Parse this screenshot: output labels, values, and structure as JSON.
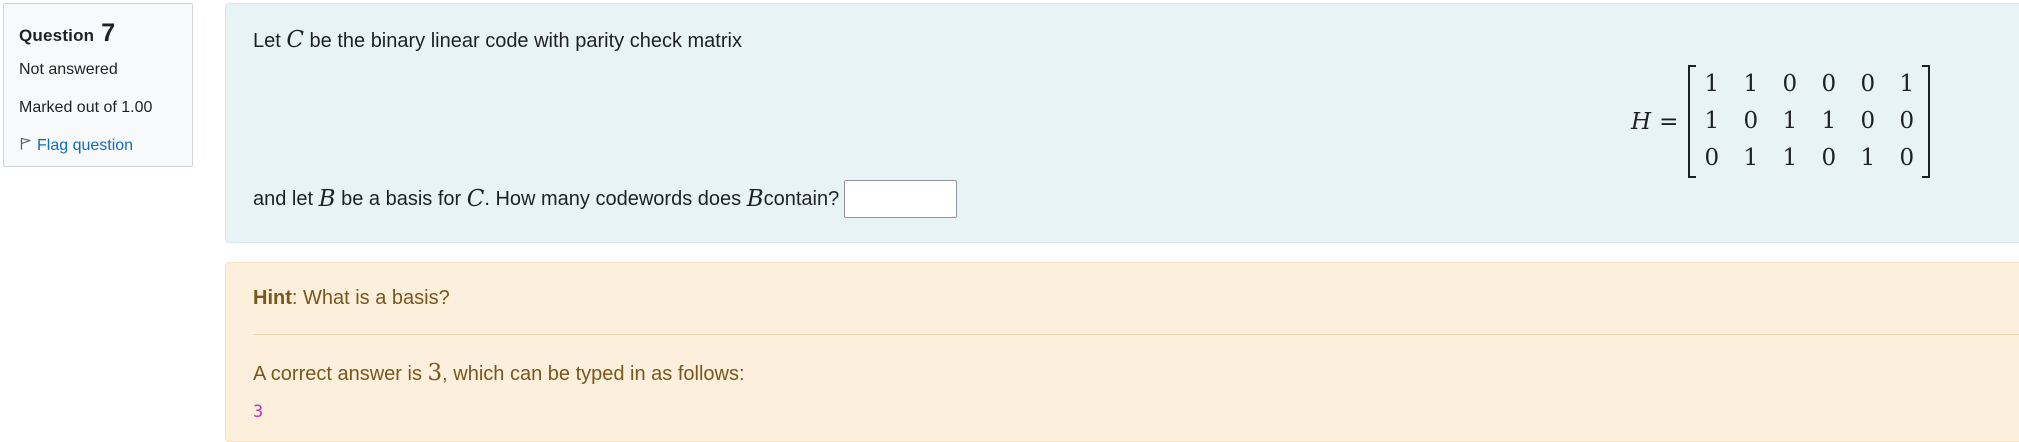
{
  "info": {
    "question_label": "Question",
    "question_number": "7",
    "state": "Not answered",
    "grade": "Marked out of 1.00",
    "flag_label": "Flag question"
  },
  "question": {
    "text1_pre": "Let ",
    "var_c": "C",
    "text1_post": " be the binary linear code with parity check matrix",
    "matrix_label": "H",
    "matrix_eq": "=",
    "matrix": [
      [
        "1",
        "1",
        "0",
        "0",
        "0",
        "1"
      ],
      [
        "1",
        "0",
        "1",
        "1",
        "0",
        "0"
      ],
      [
        "0",
        "1",
        "1",
        "0",
        "1",
        "0"
      ]
    ],
    "text2_pre": "and let ",
    "var_b": "B",
    "text2_mid1": " be a basis for ",
    "var_c2": "C",
    "text2_mid2": ". How many codewords does ",
    "var_b2": "B",
    "text2_post": " contain?",
    "answer_value": ""
  },
  "feedback": {
    "hint_label": "Hint",
    "hint_text": ": What is a basis?",
    "answer_pre": "A correct answer is ",
    "answer_value": "3",
    "answer_post": ", which can be typed in as follows:",
    "code": "3"
  },
  "colors": {
    "formulation_bg": "#e7f3f5",
    "outcome_bg": "#fcefdc",
    "outcome_text": "#7a561b",
    "link": "#0f6cbf",
    "code": "#c034b8"
  }
}
